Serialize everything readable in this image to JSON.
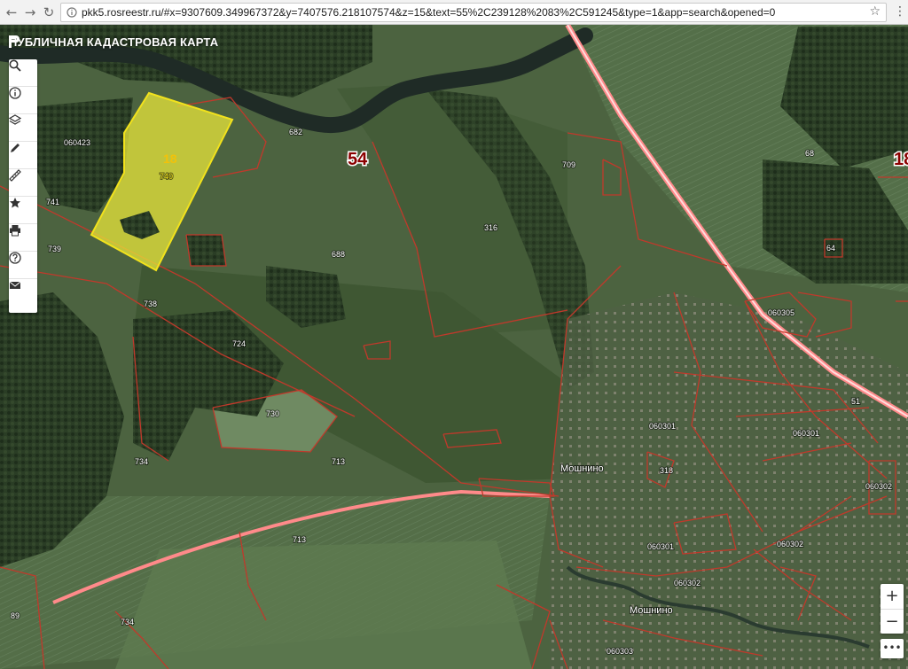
{
  "browser": {
    "url": "pkk5.rosreestr.ru/#x=9307609.349967372&y=7407576.218107574&z=15&text=55%2C239128%2083%2C591245&type=1&app=search&opened=0"
  },
  "app": {
    "title": "ПУБЛИЧНАЯ КАДАСТРОВАЯ КАРТА"
  },
  "toolbar": {
    "tools": [
      {
        "name": "search-button",
        "icon": "search-icon"
      },
      {
        "name": "info-button",
        "icon": "info-icon"
      },
      {
        "name": "layers-button",
        "icon": "layers-icon"
      },
      {
        "name": "draw-button",
        "icon": "pencil-icon"
      },
      {
        "name": "measure-button",
        "icon": "ruler-icon"
      },
      {
        "name": "favorites-button",
        "icon": "star-icon"
      },
      {
        "name": "print-button",
        "icon": "printer-icon"
      },
      {
        "name": "help-button",
        "icon": "help-icon"
      },
      {
        "name": "feedback-button",
        "icon": "mail-icon"
      }
    ]
  },
  "zoom": {
    "in_label": "+",
    "out_label": "−",
    "more_label": "•••"
  },
  "map": {
    "district_label": "54",
    "district_label_right": "18",
    "selected_parcel": {
      "label": "18",
      "sub_label": "740"
    },
    "place_labels": [
      "Мошнино",
      "Мошнино"
    ],
    "quarter_labels": [
      "060423",
      "060301",
      "060301",
      "060302",
      "060301",
      "060302",
      "060302",
      "060303",
      "060305"
    ],
    "parcel_labels": [
      "682",
      "709",
      "68",
      "741",
      "739",
      "688",
      "316",
      "738",
      "724",
      "730",
      "734",
      "713",
      "713",
      "734",
      "89",
      "318",
      "51",
      "64"
    ],
    "colors": {
      "parcel_border": "#c0392b",
      "road_border": "#ff8a8a",
      "selected_fill": "#e8e63a",
      "river": "#1f2b26"
    }
  }
}
